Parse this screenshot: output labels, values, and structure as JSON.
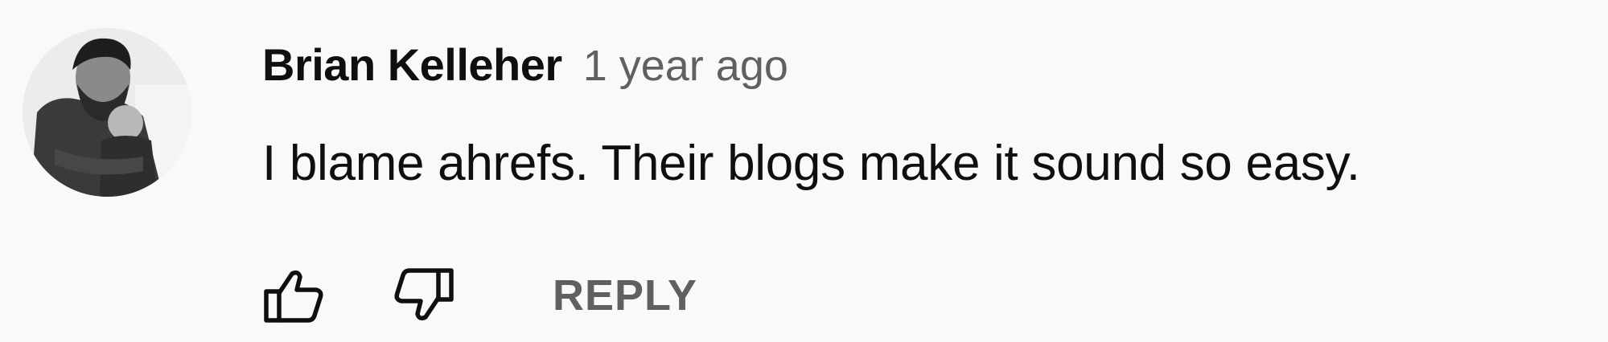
{
  "comment": {
    "author": "Brian Kelleher",
    "timestamp": "1 year ago",
    "text": "I blame ahrefs. Their blogs make it sound so easy.",
    "avatar_icon": "user-avatar-photo"
  },
  "actions": {
    "like_icon": "thumbs-up-icon",
    "dislike_icon": "thumbs-down-icon",
    "reply_label": "REPLY"
  },
  "colors": {
    "background": "#f9f9f9",
    "author_text": "#0f0f0f",
    "meta_text": "#606060",
    "icon_stroke": "#0f0f0f"
  }
}
